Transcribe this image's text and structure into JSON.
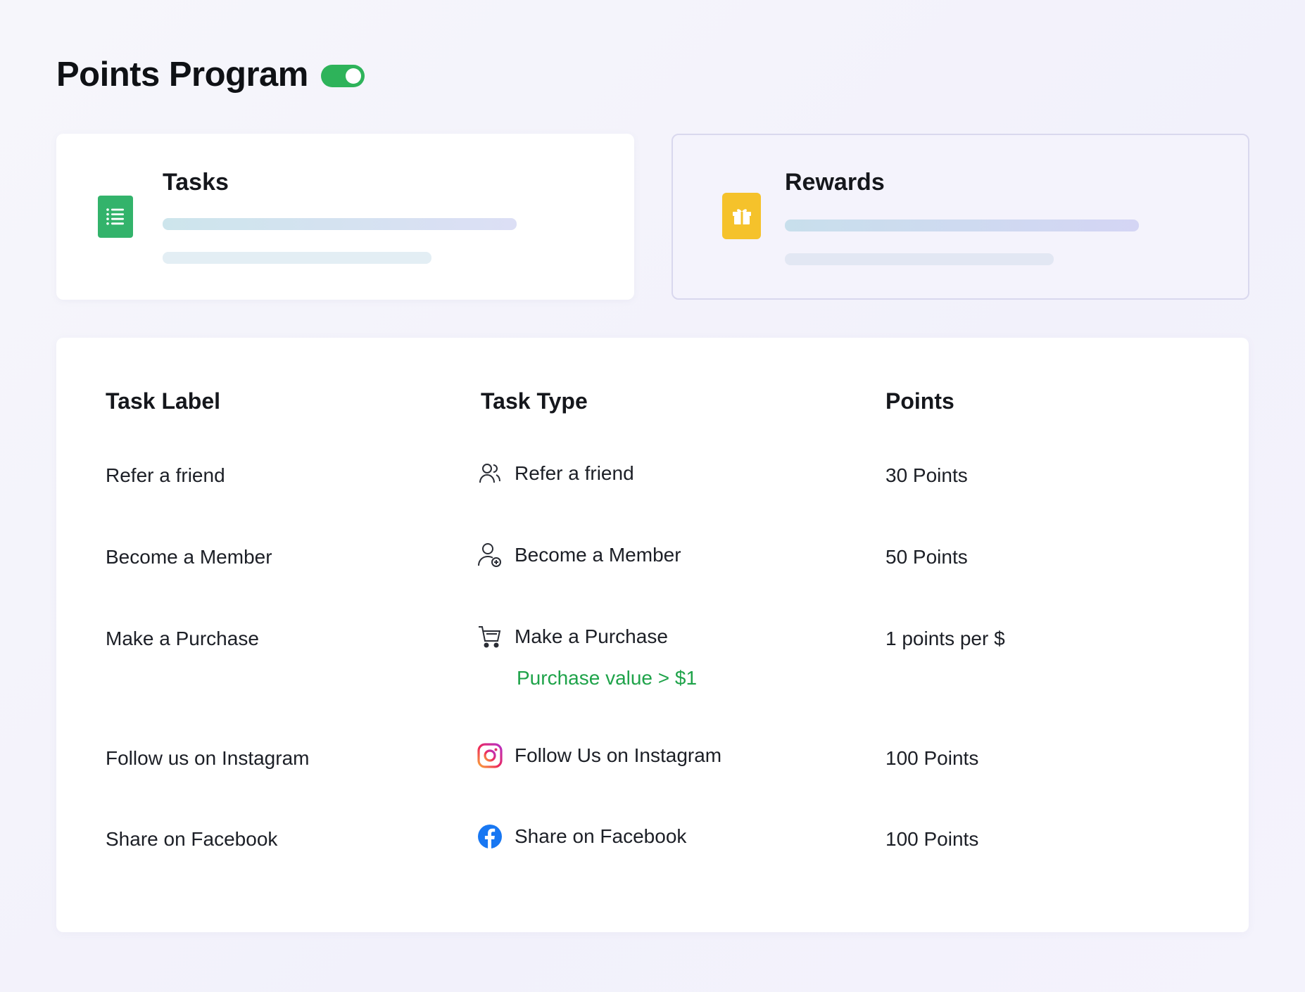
{
  "header": {
    "title": "Points Program",
    "toggle_on": true,
    "toggle_color": "#2eb35a"
  },
  "cards": {
    "tasks": {
      "title": "Tasks",
      "icon": "list-icon",
      "icon_color": "#33b36b"
    },
    "rewards": {
      "title": "Rewards",
      "icon": "gift-icon",
      "icon_color": "#f5c22b"
    }
  },
  "table": {
    "headers": [
      "Task Label",
      "Task Type",
      "Points"
    ],
    "rows": [
      {
        "label": "Refer a friend",
        "type_icon": "users-icon",
        "type": "Refer a friend",
        "condition": "",
        "points": "30 Points"
      },
      {
        "label": "Become a Member",
        "type_icon": "user-add-icon",
        "type": "Become a Member",
        "condition": "",
        "points": "50 Points"
      },
      {
        "label": "Make a Purchase",
        "type_icon": "cart-icon",
        "type": "Make a Purchase",
        "condition": "Purchase value > $1",
        "points": "1 points per $"
      },
      {
        "label": "Follow us on Instagram",
        "type_icon": "instagram-icon",
        "type": "Follow Us on Instagram",
        "condition": "",
        "points": "100 Points"
      },
      {
        "label": "Share on Facebook",
        "type_icon": "facebook-icon",
        "type": "Share on Facebook",
        "condition": "",
        "points": "100 Points"
      }
    ],
    "condition_color": "#1fa34a"
  }
}
